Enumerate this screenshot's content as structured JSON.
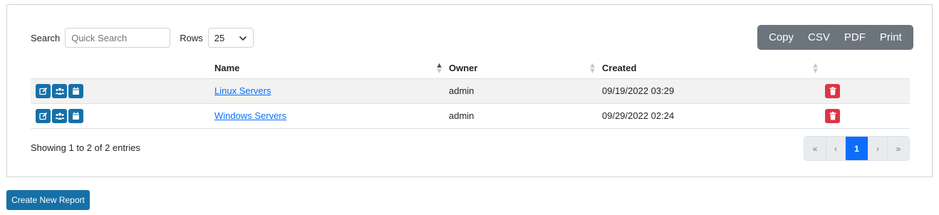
{
  "toolbar": {
    "search_label": "Search",
    "search_placeholder": "Quick Search",
    "search_value": "",
    "rows_label": "Rows",
    "rows_value": "25"
  },
  "export_buttons": [
    "Copy",
    "CSV",
    "PDF",
    "Print"
  ],
  "table": {
    "headers": [
      "Name",
      "Owner",
      "Created"
    ],
    "rows": [
      {
        "name": "Linux Servers",
        "owner": "admin",
        "created": "09/19/2022 03:29"
      },
      {
        "name": "Windows Servers",
        "owner": "admin",
        "created": "09/29/2022 02:24"
      }
    ]
  },
  "footer": {
    "info": "Showing 1 to 2 of 2 entries",
    "pagination": {
      "first": "«",
      "prev": "‹",
      "current": "1",
      "next": "›",
      "last": "»"
    }
  },
  "create_button": "Create New Report",
  "colors": {
    "primary_blue": "#1670a8",
    "danger": "#dc3545",
    "export_gray": "#6c757d",
    "page_active": "#0d6efd"
  }
}
